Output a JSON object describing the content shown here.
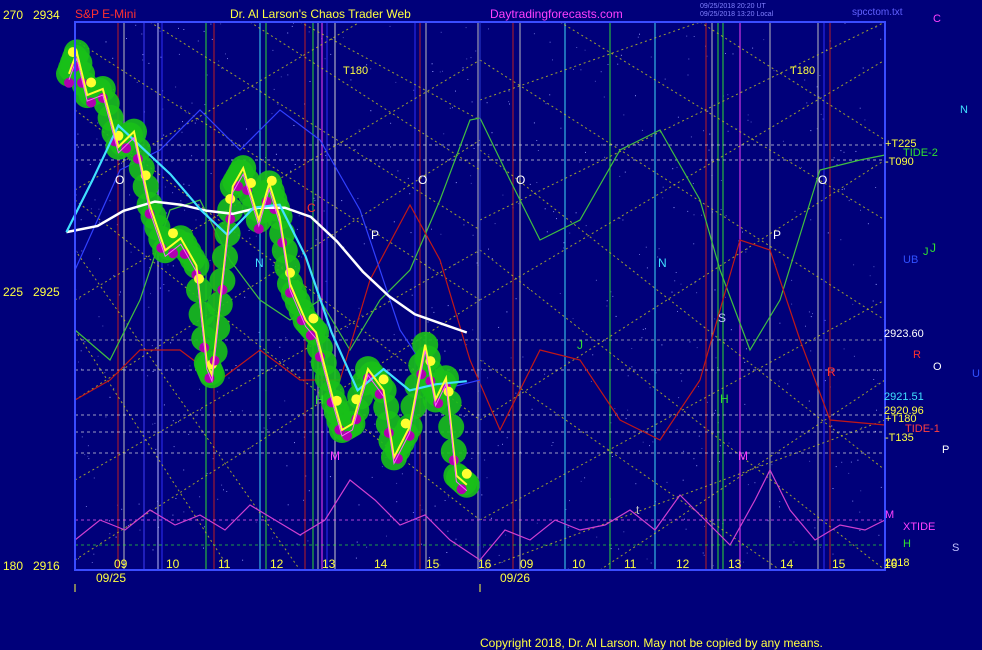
{
  "header": {
    "instrument": "S&P E-Mini",
    "site": "Dr. Al Larson's Chaos Trader Web",
    "domain": "Daytradingforecasts.com",
    "stamp1": "09/25/2018 20:20 UT",
    "stamp2": "09/25/2018 13:20 Local",
    "file": "spcctom.txt",
    "copyright": "Copyright 2018, Dr. Al Larson. May not be copied by any means."
  },
  "colors": {
    "background": "#00007a",
    "plot_border": "#3a4cff",
    "price_green": "#18c018",
    "price_magenta": "#b000b0",
    "yellow": "#ffff30",
    "cyan": "#40e0ff",
    "white": "#ffffff",
    "green_line": "#40c040",
    "red_line": "#c01818",
    "xtide": "#d040d0"
  },
  "chart_data": {
    "type": "line",
    "title": "S&P E-Mini",
    "y_left_labels": [
      {
        "a": "270",
        "p": "2934"
      },
      {
        "a": "225",
        "p": "2925"
      },
      {
        "a": "180",
        "p": "2916"
      }
    ],
    "ylim": [
      2916,
      2934
    ],
    "x_hours_day1": [
      "09",
      "10",
      "11",
      "12",
      "13",
      "14",
      "15",
      "16"
    ],
    "x_hours_day2": [
      "09",
      "10",
      "11",
      "12",
      "13",
      "14",
      "15",
      "16"
    ],
    "x_dates": [
      "09/25",
      "09/26"
    ],
    "right_price_labels": [
      "2923.60",
      "2921.51",
      "2920.96"
    ],
    "right_line_labels": [
      "+T225",
      "-T090",
      "TIDE-2",
      "+T180",
      "TIDE-1",
      "-T135",
      "XTIDE",
      "2018"
    ],
    "right_letters": [
      "C",
      "N",
      "J",
      "UB",
      "R",
      "O",
      "U",
      "P",
      "M",
      "H",
      "S"
    ],
    "chart_letters_top": [
      "T180",
      "T180"
    ],
    "chart_letters": [
      "O",
      "O",
      "O",
      "O",
      "P",
      "P",
      "N",
      "N",
      "S",
      "J",
      "J",
      "H",
      "H",
      "M",
      "M",
      "R",
      "t",
      "C"
    ],
    "series": [
      {
        "name": "S&P",
        "x": [
          8.25,
          8.4,
          8.6,
          8.9,
          9.2,
          9.5,
          9.8,
          10.1,
          10.4,
          10.7,
          10.9,
          11.0,
          11.2,
          11.4,
          11.6,
          11.9,
          12.1,
          12.3,
          12.5,
          12.8,
          13.0,
          13.3,
          13.5,
          13.7,
          14.0,
          14.3,
          14.5,
          14.8,
          15.1,
          15.3,
          15.5,
          15.7,
          15.9
        ],
        "values": [
          2932.3,
          2933.0,
          2931.6,
          2931.8,
          2929.9,
          2930.4,
          2928.0,
          2926.5,
          2926.9,
          2926.0,
          2922.8,
          2922.4,
          2925.5,
          2928.6,
          2929.2,
          2927.5,
          2928.7,
          2927.6,
          2925.4,
          2924.2,
          2923.8,
          2921.8,
          2920.6,
          2920.8,
          2922.6,
          2921.9,
          2919.7,
          2920.7,
          2923.4,
          2921.6,
          2922.3,
          2919.1,
          2918.8
        ]
      },
      {
        "name": "EMA",
        "x": [
          8.2,
          8.7,
          9.2,
          9.7,
          10.2,
          10.8,
          11.3,
          11.8,
          12.3,
          12.8,
          13.3,
          13.8,
          14.3,
          14.8,
          15.3,
          15.9
        ],
        "values": [
          2927.1,
          2928.8,
          2930.6,
          2929.8,
          2929.0,
          2927.8,
          2927.0,
          2927.9,
          2928.0,
          2926.3,
          2923.8,
          2921.9,
          2922.6,
          2921.9,
          2922.1,
          2922.2
        ]
      },
      {
        "name": "SMA",
        "x": [
          8.2,
          8.8,
          9.3,
          9.9,
          10.4,
          10.9,
          11.4,
          11.9,
          12.4,
          12.9,
          13.4,
          13.9,
          14.4,
          14.9,
          15.4,
          15.9
        ],
        "values": [
          2927.1,
          2927.3,
          2927.8,
          2928.1,
          2928.0,
          2927.8,
          2927.7,
          2927.9,
          2927.9,
          2927.6,
          2926.8,
          2925.8,
          2925.0,
          2924.4,
          2924.1,
          2923.8
        ]
      }
    ]
  }
}
